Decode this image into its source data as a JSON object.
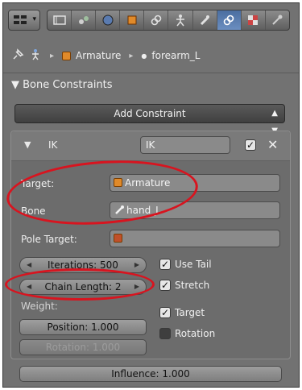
{
  "breadcrumb": {
    "object": "Armature",
    "bone": "forearm_L"
  },
  "panel": {
    "title": "Bone Constraints",
    "add_label": "Add Constraint"
  },
  "constraint": {
    "type_label": "IK",
    "name_value": "IK",
    "target_label": "Target:",
    "target_value": "Armature",
    "bone_label": "Bone",
    "bone_value": "hand_L",
    "pole_label": "Pole Target:",
    "iterations": "Iterations: 500",
    "chain_length": "Chain Length: 2",
    "weight_label": "Weight:",
    "position": "Position: 1.000",
    "rotation_weight": "Rotation: 1.000",
    "use_tail": "Use Tail",
    "stretch": "Stretch",
    "target_toggle": "Target",
    "rotation_toggle": "Rotation",
    "influence": "Influence: 1.000"
  },
  "accent": {
    "annotation_red": "#d8141f",
    "active_tab": "#5b7eb0"
  }
}
